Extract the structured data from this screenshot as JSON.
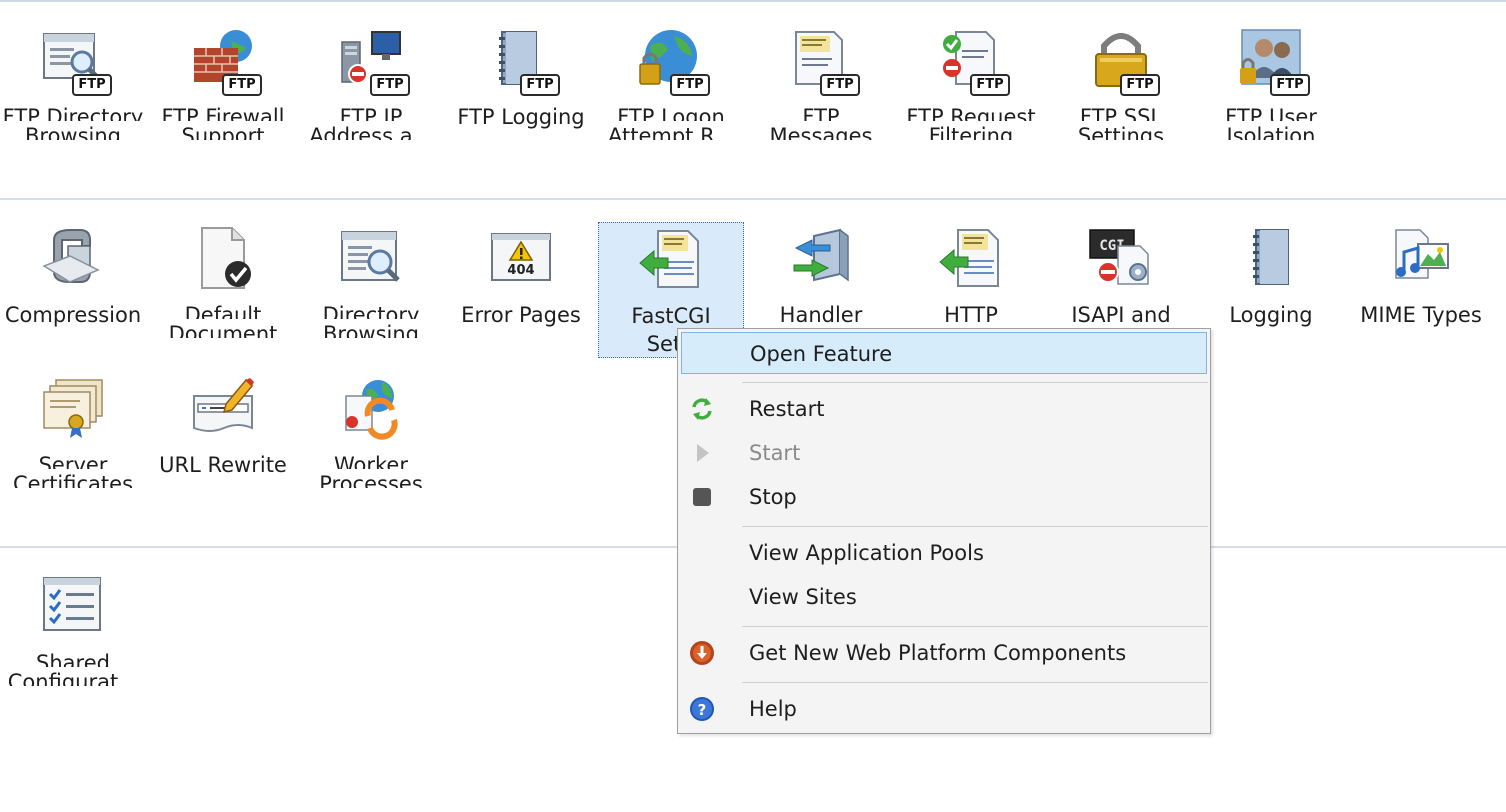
{
  "ftp_features": [
    {
      "label1": "FTP Directory",
      "label2": "Browsing",
      "icon": "ftp-directory-browsing-icon"
    },
    {
      "label1": "FTP Firewall",
      "label2": "Support",
      "icon": "ftp-firewall-icon"
    },
    {
      "label1": "FTP IP",
      "label2": "Address a...",
      "icon": "ftp-ip-address-icon"
    },
    {
      "label1": "FTP Logging",
      "label2": "",
      "icon": "ftp-logging-icon"
    },
    {
      "label1": "FTP Logon",
      "label2": "Attempt R...",
      "icon": "ftp-logon-attempt-icon"
    },
    {
      "label1": "FTP",
      "label2": "Messages",
      "icon": "ftp-messages-icon"
    },
    {
      "label1": "FTP Request",
      "label2": "Filtering",
      "icon": "ftp-request-filtering-icon"
    },
    {
      "label1": "FTP SSL",
      "label2": "Settings",
      "icon": "ftp-ssl-icon"
    },
    {
      "label1": "FTP User",
      "label2": "Isolation",
      "icon": "ftp-user-isolation-icon"
    }
  ],
  "ftp_badge": "FTP",
  "iis_features": [
    {
      "label1": "Compression",
      "label2": "",
      "icon": "compression-icon"
    },
    {
      "label1": "Default",
      "label2": "Document",
      "icon": "default-document-icon"
    },
    {
      "label1": "Directory",
      "label2": "Browsing",
      "icon": "directory-browsing-icon"
    },
    {
      "label1": "Error Pages",
      "label2": "",
      "icon": "error-pages-icon"
    },
    {
      "label1": "FastCGI",
      "label2": "Setti",
      "icon": "fastcgi-icon"
    },
    {
      "label1": "Handler",
      "label2": "",
      "icon": "handler-mappings-icon"
    },
    {
      "label1": "HTTP",
      "label2": "",
      "icon": "http-response-headers-icon"
    },
    {
      "label1": "ISAPI and",
      "label2": "",
      "icon": "isapi-cgi-icon"
    },
    {
      "label1": "Logging",
      "label2": "",
      "icon": "logging-icon"
    },
    {
      "label1": "MIME Types",
      "label2": "",
      "icon": "mime-types-icon"
    },
    {
      "label1": "Server",
      "label2": "Certificates",
      "icon": "server-certificates-icon"
    },
    {
      "label1": "URL Rewrite",
      "label2": "",
      "icon": "url-rewrite-icon"
    },
    {
      "label1": "Worker",
      "label2": "Processes",
      "icon": "worker-processes-icon"
    }
  ],
  "management_features": [
    {
      "label1": "Shared",
      "label2": "Configurat...",
      "icon": "shared-configuration-icon"
    }
  ],
  "error_icon_text": "404",
  "cgi_icon_text": "CGI",
  "context_menu": {
    "open_feature": "Open Feature",
    "restart": "Restart",
    "start": "Start",
    "stop": "Stop",
    "view_app_pools": "View Application Pools",
    "view_sites": "View Sites",
    "get_components": "Get New Web Platform Components",
    "help": "Help"
  },
  "colors": {
    "selection_bg": "#d9ebfa",
    "menu_highlight": "#d7ecfa",
    "menu_bg": "#f4f4f4",
    "separator": "#d4dde9"
  }
}
